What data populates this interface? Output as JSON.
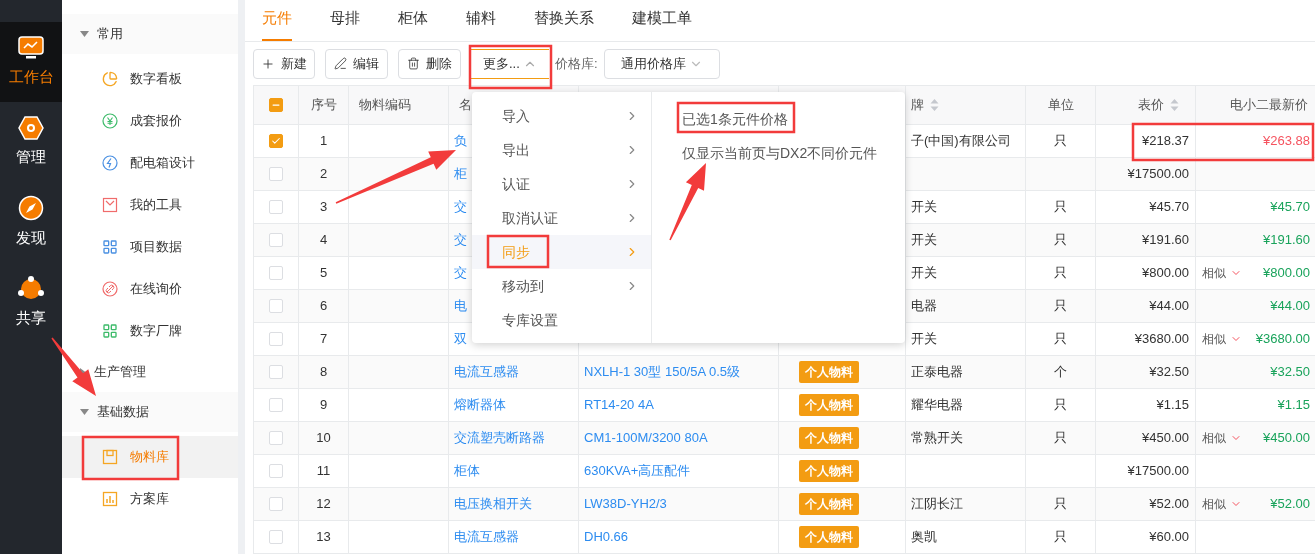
{
  "rail": [
    {
      "label": "工作台",
      "selected": true
    },
    {
      "label": "管理",
      "selected": false
    },
    {
      "label": "发现",
      "selected": false
    },
    {
      "label": "共享",
      "selected": false
    }
  ],
  "sidebar": {
    "groups": [
      {
        "label": "常用",
        "expanded": true,
        "items": [
          {
            "label": "数字看板",
            "selected": false
          },
          {
            "label": "成套报价",
            "selected": false
          },
          {
            "label": "配电箱设计",
            "selected": false
          },
          {
            "label": "我的工具",
            "selected": false
          },
          {
            "label": "项目数据",
            "selected": false
          },
          {
            "label": "在线询价",
            "selected": false
          },
          {
            "label": "数字厂牌",
            "selected": false
          }
        ]
      },
      {
        "label": "生产管理",
        "expanded": false
      },
      {
        "label": "基础数据",
        "expanded": true,
        "items": [
          {
            "label": "物料库",
            "selected": true
          },
          {
            "label": "方案库",
            "selected": false
          }
        ]
      }
    ]
  },
  "tabs": [
    {
      "label": "元件",
      "selected": true
    },
    {
      "label": "母排",
      "selected": false
    },
    {
      "label": "柜体",
      "selected": false
    },
    {
      "label": "辅料",
      "selected": false
    },
    {
      "label": "替换关系",
      "selected": false
    },
    {
      "label": "建模工单",
      "selected": false
    }
  ],
  "toolbar": {
    "buttons": [
      {
        "label": "新建",
        "kind": "new"
      },
      {
        "label": "编辑",
        "kind": "edit"
      },
      {
        "label": "删除",
        "kind": "delete"
      },
      {
        "label": "更多...",
        "kind": "more",
        "open": true
      }
    ],
    "price_library": {
      "label": "价格库:",
      "value": "通用价格库"
    }
  },
  "menu": {
    "items": [
      {
        "label": "导入",
        "submenu": true,
        "selected": false
      },
      {
        "label": "导出",
        "submenu": true,
        "selected": false
      },
      {
        "label": "认证",
        "submenu": true,
        "selected": false
      },
      {
        "label": "取消认证",
        "submenu": true,
        "selected": false
      },
      {
        "label": "同步",
        "submenu": true,
        "selected": true
      },
      {
        "label": "移动到",
        "submenu": true,
        "selected": false
      },
      {
        "label": "专库设置",
        "submenu": false,
        "selected": false
      }
    ],
    "submenu_items": [
      "已选1条元件价格",
      "仅显示当前页与DX2不同价元件"
    ]
  },
  "table": {
    "header": {
      "select_all_indeterminate": true,
      "index": "序号",
      "code": "物料编码",
      "name": "名",
      "brand": "牌",
      "unit": "单位",
      "price": "表价",
      "latest": "电小二最新价"
    },
    "rows": [
      {
        "selected": true,
        "index": "1",
        "name": "负",
        "brand": "子(中国)有限公司",
        "unit": "只",
        "price": "¥218.37",
        "latest": "¥263.88",
        "color": "#f5535f"
      },
      {
        "selected": false,
        "index": "2",
        "name": "柜",
        "price": "¥17500.00"
      },
      {
        "selected": false,
        "index": "3",
        "name": "交",
        "brand": "开关",
        "unit": "只",
        "price": "¥45.70",
        "latest": "¥45.70",
        "color": "#19a35b"
      },
      {
        "selected": false,
        "index": "4",
        "name": "交",
        "brand": "开关",
        "unit": "只",
        "price": "¥191.60",
        "latest": "¥191.60",
        "color": "#19a35b"
      },
      {
        "selected": false,
        "index": "5",
        "name": "交",
        "brand": "开关",
        "unit": "只",
        "price": "¥800.00",
        "similar": "相似",
        "latest": "¥800.00",
        "color": "#19a35b"
      },
      {
        "selected": false,
        "index": "6",
        "name": "电",
        "brand": "电器",
        "unit": "只",
        "price": "¥44.00",
        "latest": "¥44.00",
        "color": "#19a35b"
      },
      {
        "selected": false,
        "index": "7",
        "name": "双",
        "brand": "开关",
        "unit": "只",
        "price": "¥3680.00",
        "similar": "相似",
        "latest": "¥3680.00",
        "color": "#19a35b"
      },
      {
        "selected": false,
        "index": "8",
        "name": "电流互感器",
        "model": "NXLH-1 30型 150/5A 0.5级",
        "tag": "个人物料",
        "brand": "正泰电器",
        "unit": "个",
        "price": "¥32.50",
        "latest": "¥32.50",
        "color": "#19a35b"
      },
      {
        "selected": false,
        "index": "9",
        "name": "熔断器体",
        "model": "RT14-20 4A",
        "tag": "个人物料",
        "brand": "耀华电器",
        "unit": "只",
        "price": "¥1.15",
        "latest": "¥1.15",
        "color": "#19a35b"
      },
      {
        "selected": false,
        "index": "10",
        "name": "交流塑壳断路器",
        "model": "CM1-100M/3200 80A",
        "tag": "个人物料",
        "brand": "常熟开关",
        "unit": "只",
        "price": "¥450.00",
        "similar": "相似",
        "latest": "¥450.00",
        "color": "#19a35b"
      },
      {
        "selected": false,
        "index": "11",
        "name": "柜体",
        "model": "630KVA+高压配件",
        "tag": "个人物料",
        "price": "¥17500.00"
      },
      {
        "selected": false,
        "index": "12",
        "name": "电压换相开关",
        "model": "LW38D-YH2/3",
        "tag": "个人物料",
        "brand": "江阴长江",
        "unit": "只",
        "price": "¥52.00",
        "similar": "相似",
        "latest": "¥52.00",
        "color": "#19a35b"
      },
      {
        "selected": false,
        "index": "13",
        "name": "电流互感器",
        "model": "DH0.66",
        "tag": "个人物料",
        "brand": "奥凯",
        "unit": "只",
        "price": "¥60.00"
      }
    ]
  }
}
